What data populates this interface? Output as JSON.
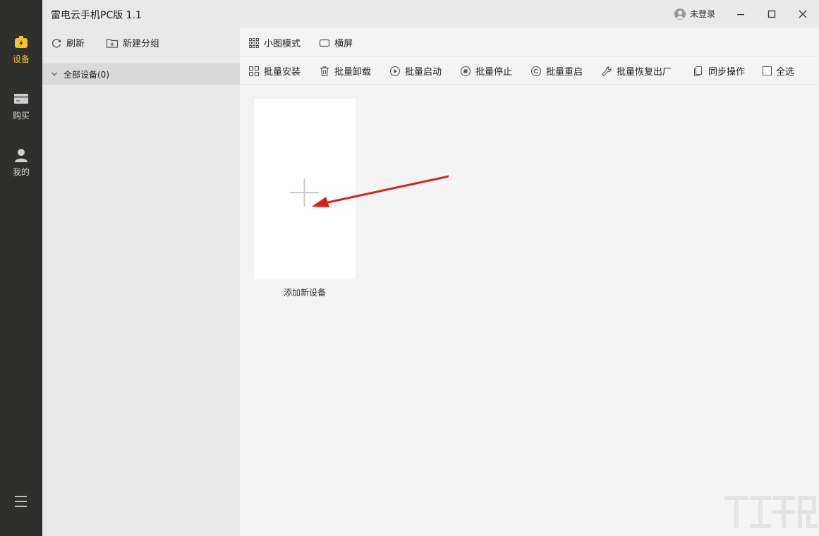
{
  "app": {
    "title": "雷电云手机PC版 1.1"
  },
  "account": {
    "login_label": "未登录"
  },
  "rail": {
    "items": [
      {
        "label": "设备",
        "icon": "device-battery-icon",
        "active": true
      },
      {
        "label": "购买",
        "icon": "card-icon",
        "active": false
      },
      {
        "label": "我的",
        "icon": "person-icon",
        "active": false
      }
    ],
    "menu_icon": "hamburger-icon"
  },
  "groups": {
    "toolbar": {
      "refresh_label": "刷新",
      "new_group_label": "新建分组"
    },
    "items": [
      {
        "label": "全部设备(0)"
      }
    ]
  },
  "main": {
    "view_modes": {
      "small_label": "小图模式",
      "landscape_label": "横屏"
    },
    "batch": {
      "install": "批量安装",
      "uninstall": "批量卸载",
      "start": "批量启动",
      "stop": "批量停止",
      "restart": "批量重启",
      "restore": "批量恢复出厂",
      "sync": "同步操作",
      "select_all": "全选"
    },
    "add_device_label": "添加新设备"
  },
  "colors": {
    "accent": "#f6c02e",
    "rail_bg": "#2f2f2d",
    "arrow": "#d9201c"
  }
}
